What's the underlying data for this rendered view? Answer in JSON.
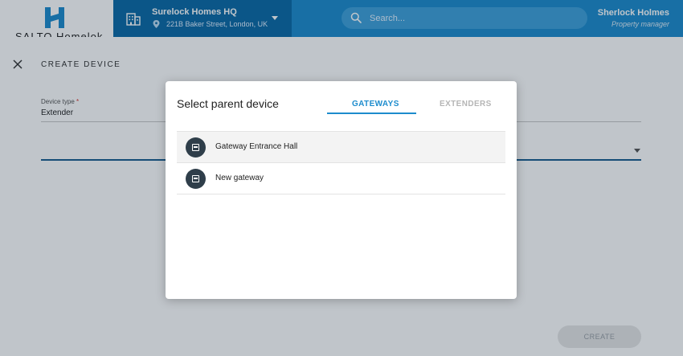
{
  "header": {
    "logo_text": "SALTO Homelok",
    "site_name": "Surelock Homes HQ",
    "site_address": "221B Baker Street, London, UK",
    "search_placeholder": "Search...",
    "user_name": "Sherlock Holmes",
    "user_role": "Property manager"
  },
  "page": {
    "title": "CREATE DEVICE",
    "device_type_label": "Device type",
    "device_type_required": "*",
    "device_type_value": "Extender",
    "create_label": "CREATE"
  },
  "modal": {
    "title": "Select parent device",
    "tabs": [
      {
        "label": "GATEWAYS",
        "active": true
      },
      {
        "label": "EXTENDERS",
        "active": false
      }
    ],
    "devices": [
      {
        "name": "Gateway Entrance Hall",
        "icon": "gateway-icon"
      },
      {
        "name": "New gateway",
        "icon": "gateway-icon"
      }
    ]
  },
  "colors": {
    "primary": "#1d8ccd",
    "site_bar": "#0c6aa6",
    "device_icon": "#2f3e4a"
  }
}
